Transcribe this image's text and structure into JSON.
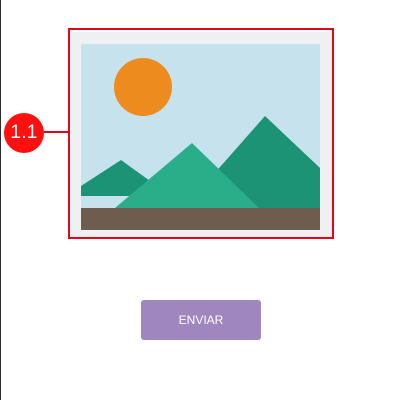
{
  "annotation": {
    "label": "1.1",
    "color": "#e3061a"
  },
  "image_placeholder": {
    "icon": "image-placeholder-icon",
    "colors": {
      "frame": "#eef0f1",
      "sky": "#c5e2ed",
      "sun": "#ee8b1f",
      "mountain_back": "#1b9374",
      "mountain_front": "#2aae89",
      "ground": "#6e5d4e"
    }
  },
  "form": {
    "submit_label": "ENVIAR",
    "submit_color": "#a086bf"
  }
}
